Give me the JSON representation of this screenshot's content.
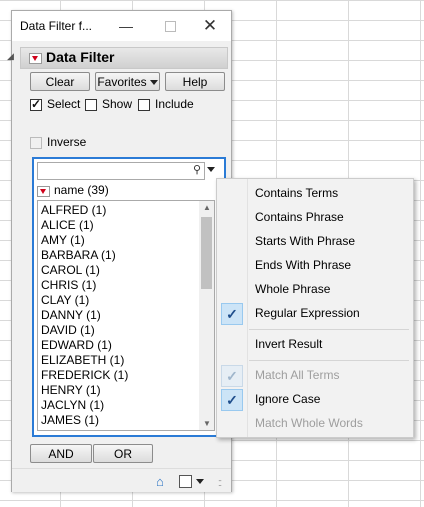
{
  "window": {
    "title": "Data Filter f..."
  },
  "header": {
    "title": "Data Filter"
  },
  "buttons": {
    "clear": "Clear",
    "favorites": "Favorites",
    "help": "Help",
    "and": "AND",
    "or": "OR"
  },
  "options": {
    "select": "Select",
    "show": "Show",
    "include": "Include",
    "inverse": "Inverse"
  },
  "checks": {
    "select": true,
    "show": false,
    "include": false,
    "inverse": false
  },
  "search": {
    "value": "",
    "placeholder": ""
  },
  "list": {
    "header": "name (39)",
    "items": [
      "ALFRED (1)",
      "ALICE (1)",
      "AMY (1)",
      "BARBARA (1)",
      "CAROL (1)",
      "CHRIS (1)",
      "CLAY (1)",
      "DANNY (1)",
      "DAVID (1)",
      "EDWARD (1)",
      "ELIZABETH (1)",
      "FREDERICK (1)",
      "HENRY (1)",
      "JACLYN (1)",
      "JAMES (1)"
    ]
  },
  "menu": {
    "items": [
      {
        "label": "Contains Terms",
        "checked": false,
        "disabled": false
      },
      {
        "label": "Contains Phrase",
        "checked": false,
        "disabled": false
      },
      {
        "label": "Starts With Phrase",
        "checked": false,
        "disabled": false
      },
      {
        "label": "Ends With Phrase",
        "checked": false,
        "disabled": false
      },
      {
        "label": "Whole Phrase",
        "checked": false,
        "disabled": false
      },
      {
        "label": "Regular Expression",
        "checked": true,
        "disabled": false
      },
      {
        "label": "Invert Result",
        "checked": false,
        "disabled": false
      },
      {
        "label": "Match All Terms",
        "checked": true,
        "disabled": true
      },
      {
        "label": "Ignore Case",
        "checked": true,
        "disabled": false
      },
      {
        "label": "Match Whole Words",
        "checked": false,
        "disabled": true
      }
    ]
  },
  "colors": {
    "accent": "#2b7bd6",
    "red": "#d0021b",
    "menu_check": "#cce4f7"
  }
}
